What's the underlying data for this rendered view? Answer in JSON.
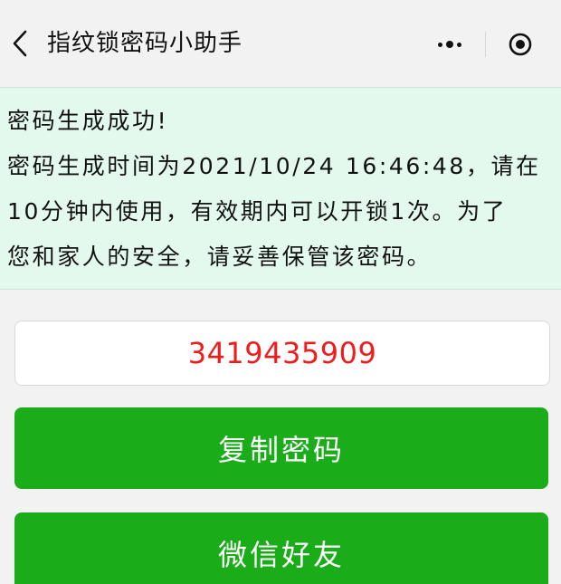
{
  "navbar": {
    "title": "指纹锁密码小助手",
    "back_icon": "chevron-left-icon",
    "more_icon": "more-dots-icon",
    "close_icon": "target-circle-icon"
  },
  "notice": {
    "line1": "密码生成成功!",
    "line2": "密码生成时间为2021/10/24 16:46:48，请在",
    "line3": "10分钟内使用，有效期内可以开锁1次。为了",
    "line4": "您和家人的安全，请妥善保管该密码。"
  },
  "password": {
    "value": "3419435909"
  },
  "buttons": {
    "copy_label": "复制密码",
    "share_label": "微信好友"
  },
  "colors": {
    "notice_bg": "#e3f9ee",
    "password_text": "#ee1c1c",
    "button_green": "#1aad19"
  }
}
